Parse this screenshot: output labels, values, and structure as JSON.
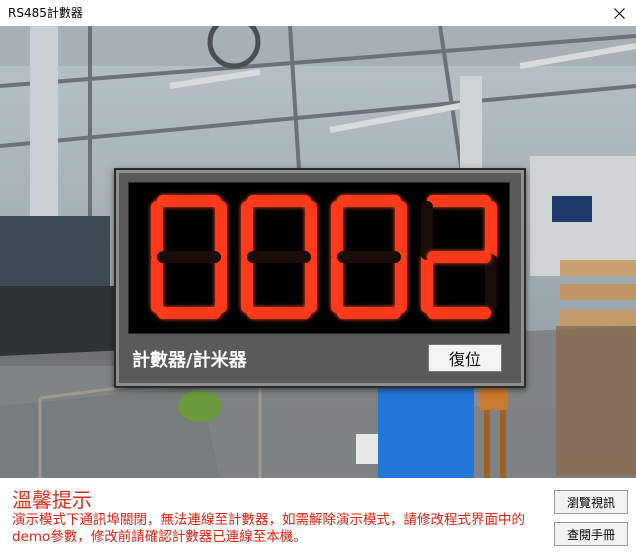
{
  "window": {
    "title": "RS485計數器",
    "close_icon": "close-icon"
  },
  "counter": {
    "digits": [
      "0",
      "0",
      "0",
      "2"
    ],
    "digit_color": "#ff3a1a",
    "label": "計數器/計米器",
    "reset_label": "復位"
  },
  "notice": {
    "title": "溫馨提示",
    "body": "演示模式下通訊埠關閉，無法連線至計數器，如需解除演示模式，請修改程式界面中的demo參數，修改前請確認計數器已連線至本機。",
    "color": "#e02010"
  },
  "buttons": {
    "browse_label": "瀏覽視訊",
    "manual_label": "查閱手冊"
  }
}
